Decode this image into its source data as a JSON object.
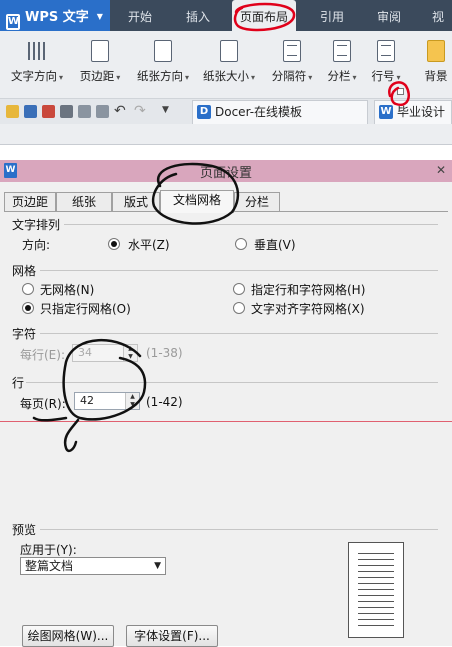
{
  "app": {
    "name": "WPS 文字"
  },
  "ribbon": {
    "tabs": [
      "开始",
      "插入",
      "页面布局",
      "引用",
      "审阅",
      "视"
    ],
    "active_tab": "页面布局",
    "items": [
      "文字方向",
      "页边距",
      "纸张方向",
      "纸张大小",
      "分隔符",
      "分栏",
      "行号",
      "背景"
    ],
    "doc_tabs": [
      "Docer-在线模板",
      "毕业设计"
    ]
  },
  "dialog": {
    "title": "页面设置",
    "tabs": [
      "页边距",
      "纸张",
      "版式",
      "文档网格",
      "分栏"
    ],
    "active_tab": "文档网格",
    "text_arrange": {
      "section": "文字排列",
      "direction_label": "方向:",
      "horizontal": "水平(Z)",
      "vertical": "垂直(V)",
      "selected": "horizontal"
    },
    "grid": {
      "section": "网格",
      "options": [
        "无网格(N)",
        "指定行和字符网格(H)",
        "只指定行网格(O)",
        "文字对齐字符网格(X)"
      ],
      "selected": "只指定行网格(O)"
    },
    "chars": {
      "section": "字符",
      "per_line_label": "每行(E):",
      "per_line_value": "34",
      "range": "(1-38)"
    },
    "lines": {
      "section": "行",
      "per_page_label": "每页(R):",
      "per_page_value": "42",
      "range": "(1-42)"
    },
    "preview": {
      "section": "预览",
      "apply_to_label": "应用于(Y):",
      "apply_to_value": "整篇文档"
    },
    "buttons": {
      "draw_grid": "绘图网格(W)...",
      "font_settings": "字体设置(F)..."
    }
  },
  "colors": {
    "title_bar": "#3b4a5c",
    "accent": "#2a6fc9",
    "dialog_title": "#d9a6bd",
    "annotation": "#e0001a"
  }
}
